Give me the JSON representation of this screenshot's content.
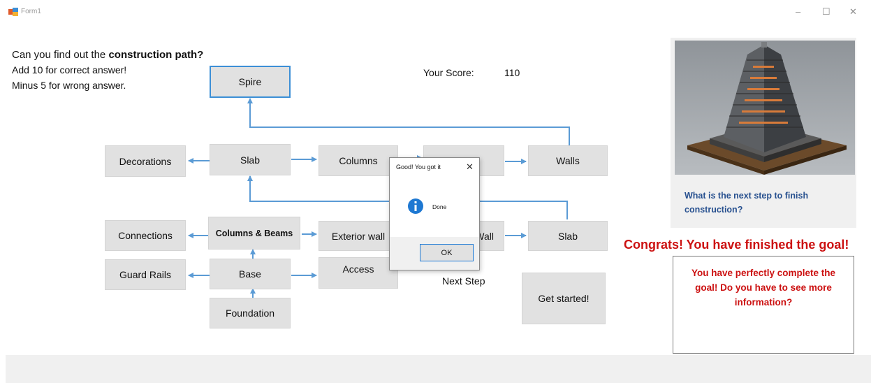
{
  "window": {
    "title": "Form1",
    "minimize_glyph": "–",
    "maximize_glyph": "☐",
    "close_glyph": "✕"
  },
  "instructions": {
    "line1_prefix": "Can you find out the",
    "line1_bold": "construction path?",
    "line2": "Add 10 for correct answer!",
    "line3": "Minus 5 for wrong answer."
  },
  "score": {
    "label": "Your Score:",
    "value": "110"
  },
  "flowchart": {
    "spire": "Spire",
    "decorations": "Decorations",
    "slab_top": "Slab",
    "columns": "Columns",
    "walls": "Walls",
    "connections": "Connections",
    "columns_beams": "Columns & Beams",
    "exterior_wall": "Exterior wall",
    "wall_partial": "Wall",
    "slab_bottom": "Slab",
    "guard_rails": "Guard Rails",
    "base": "Base",
    "access": "Access",
    "foundation": "Foundation",
    "next_step": "Next Step",
    "get_started": "Get started!"
  },
  "right_panel": {
    "question": "What is the next step to finish construction?",
    "congrats": "Congrats! You have finished the goal!",
    "message": "You have perfectly complete the goal! Do you have to see more information?"
  },
  "dialog": {
    "title": "Good! You got it",
    "close_glyph": "✕",
    "message": "Done",
    "ok_label": "OK"
  },
  "colors": {
    "arrow": "#5b9bd5",
    "accent_blue": "#3c8fd6",
    "congrats_red": "#cc1111",
    "question_blue": "#27508f",
    "button_bg": "#e1e1e1"
  }
}
